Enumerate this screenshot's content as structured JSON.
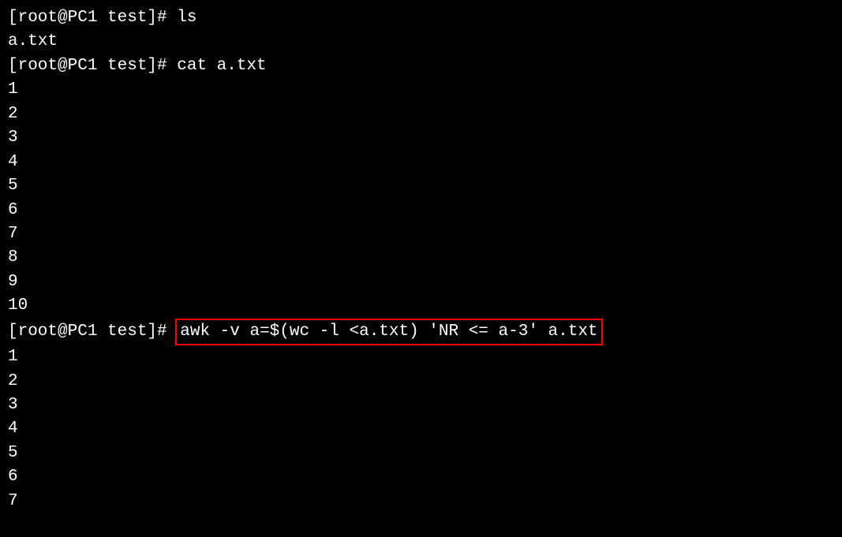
{
  "lines": {
    "l0": "[root@PC1 test]# ls",
    "l1": "a.txt",
    "l2": "[root@PC1 test]# cat a.txt",
    "l3": "1",
    "l4": "2",
    "l5": "3",
    "l6": "4",
    "l7": "5",
    "l8": "6",
    "l9": "7",
    "l10": "8",
    "l11": "9",
    "l12": "10",
    "l13_prompt": "[root@PC1 test]# ",
    "l13_highlight": "awk -v a=$(wc -l <a.txt) 'NR <= a-3' a.txt",
    "l14": "1",
    "l15": "2",
    "l16": "3",
    "l17": "4",
    "l18": "5",
    "l19": "6",
    "l20": "7"
  }
}
